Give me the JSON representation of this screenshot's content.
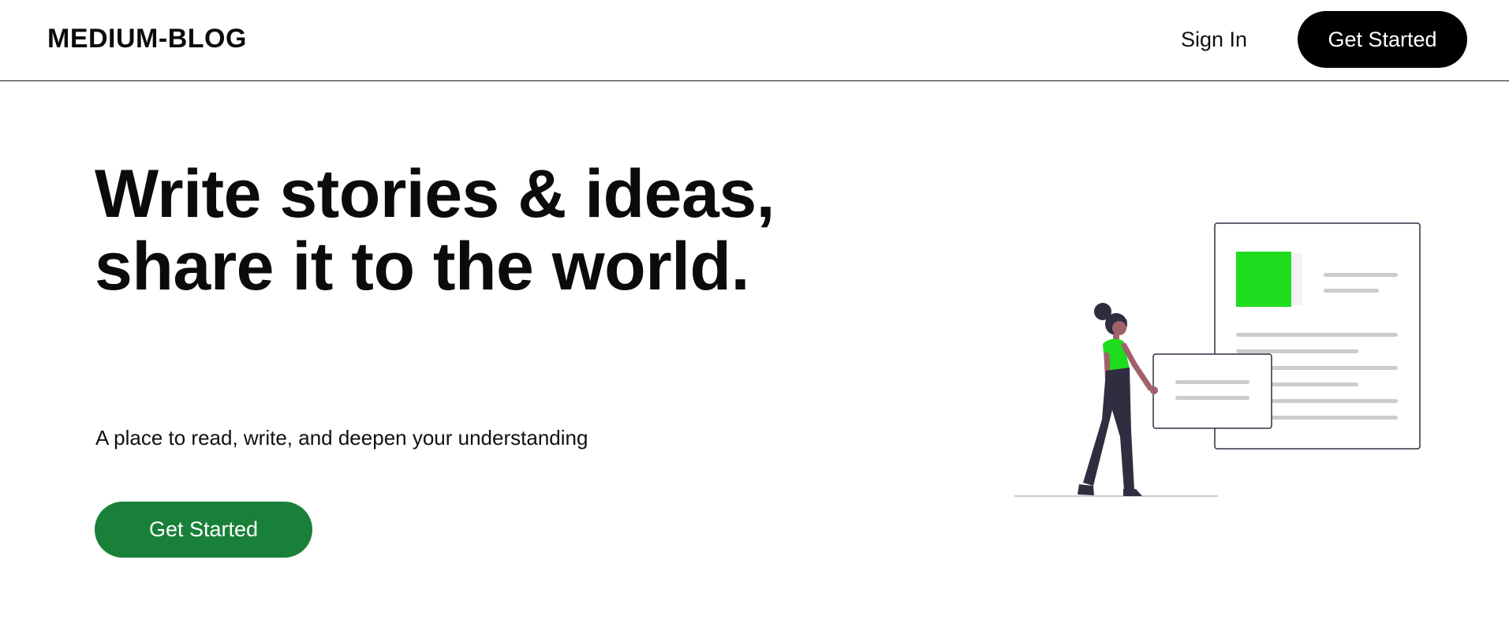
{
  "header": {
    "logo": "MEDIUM-BLOG",
    "signin_label": "Sign In",
    "cta_label": "Get Started"
  },
  "hero": {
    "title": "Write stories & ideas, share it to the world.",
    "subtitle": "A place to read, write, and deepen your understanding",
    "cta_label": "Get Started"
  },
  "colors": {
    "primary_black": "#000000",
    "cta_green": "#188038",
    "illustration_green": "#1fdc1f",
    "figure_dark": "#2f2e41"
  },
  "illustration": {
    "icon": "woman-reading-documents-illustration"
  }
}
